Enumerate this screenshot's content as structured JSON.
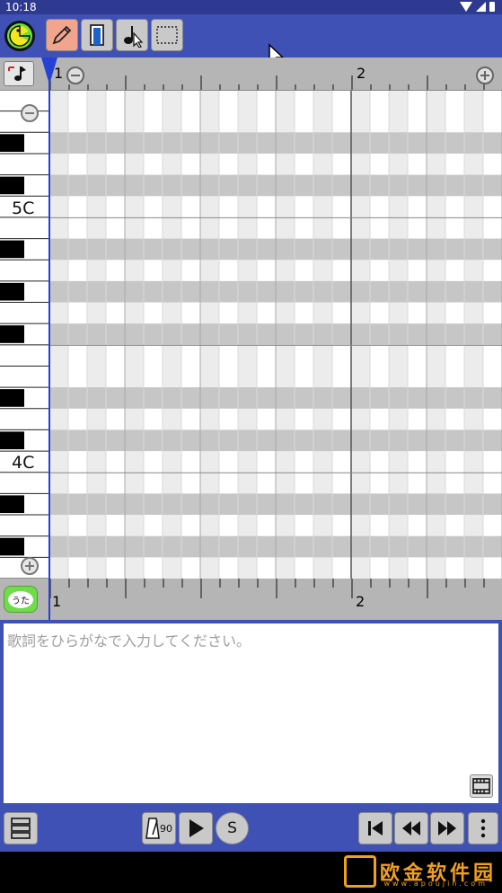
{
  "status_bar": {
    "time": "10:18"
  },
  "toolbar": {
    "tools": [
      {
        "name": "pencil-tool",
        "active": true
      },
      {
        "name": "eraser-tool",
        "active": false
      },
      {
        "name": "note-select-tool",
        "active": false
      },
      {
        "name": "range-select-tool",
        "active": false
      }
    ]
  },
  "ruler": {
    "bar_labels": [
      "1",
      "2"
    ]
  },
  "piano": {
    "octave_labels": [
      "5C",
      "4C"
    ]
  },
  "lyrics": {
    "placeholder": "歌詞をひらがなで入力してください。",
    "value": "",
    "lyric_button": "うた"
  },
  "transport": {
    "tempo": "90",
    "solo_label": "S"
  },
  "watermark": {
    "text": "欧金软件园",
    "sub": "www.apoujin.com"
  },
  "colors": {
    "accent": "#3f51b5",
    "active_tool": "#f1a58d",
    "playhead": "#2442d6"
  }
}
